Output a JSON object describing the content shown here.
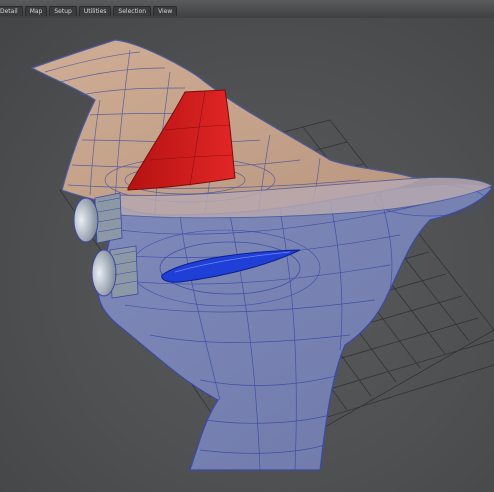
{
  "menu": {
    "tabs": [
      {
        "label": "Detail"
      },
      {
        "label": "Map"
      },
      {
        "label": "Setup"
      },
      {
        "label": "Utilities"
      },
      {
        "label": "Selection"
      },
      {
        "label": "View"
      }
    ]
  },
  "colors": {
    "background": "#4a4b4d",
    "grid": "#2c2d2f",
    "top_surface": "#c6a48c",
    "bottom_surface": "#7a85b6",
    "wire_top": "#4e5a9e",
    "wire_bottom": "#3a4aa8",
    "fin": "#d41a1a",
    "canopy": "#1f3fd6",
    "engine": "#9aa6b4"
  },
  "icons": {
    "model": "aircraft-model-icon"
  }
}
